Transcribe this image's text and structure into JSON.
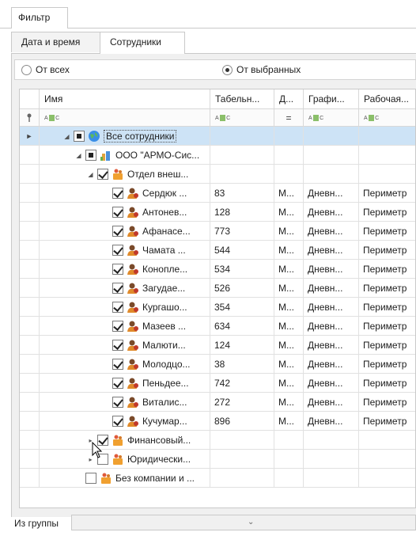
{
  "outer_tab": {
    "label": "Фильтр"
  },
  "inner_tabs": [
    {
      "label": "Дата и время"
    },
    {
      "label": "Сотрудники"
    }
  ],
  "radios": {
    "all": {
      "label": "От всех",
      "checked": false
    },
    "selected": {
      "label": "От выбранных",
      "checked": true
    }
  },
  "grid": {
    "columns": [
      "Имя",
      "Табельн...",
      "Д...",
      "Графи...",
      "Рабочая..."
    ],
    "filter_row": {
      "operator_col2": "="
    },
    "rows": [
      {
        "name": "Все сотрудники",
        "check": "partial",
        "icon": "globe-icon",
        "expander": "◢"
      },
      {
        "name": "ООО \"АРМО-Сис...",
        "check": "partial",
        "icon": "company-icon",
        "expander": "◢"
      },
      {
        "name": "Отдел внеш...",
        "check": "checked",
        "icon": "department-icon",
        "expander": "◢"
      },
      {
        "name": "Сердюк ...",
        "tab": "83",
        "d": "М...",
        "schedule": "Дневн...",
        "zone": "Периметр"
      },
      {
        "name": "Антонев...",
        "tab": "128",
        "d": "М...",
        "schedule": "Дневн...",
        "zone": "Периметр"
      },
      {
        "name": "Афанасе...",
        "tab": "773",
        "d": "М...",
        "schedule": "Дневн...",
        "zone": "Периметр"
      },
      {
        "name": "Чамата ...",
        "tab": "544",
        "d": "М...",
        "schedule": "Дневн...",
        "zone": "Периметр"
      },
      {
        "name": "Коноплe...",
        "tab": "534",
        "d": "М...",
        "schedule": "Дневн...",
        "zone": "Периметр"
      },
      {
        "name": "Загудае...",
        "tab": "526",
        "d": "М...",
        "schedule": "Дневн...",
        "zone": "Периметр"
      },
      {
        "name": "Кургашо...",
        "tab": "354",
        "d": "М...",
        "schedule": "Дневн...",
        "zone": "Периметр"
      },
      {
        "name": "Мазеев ...",
        "tab": "634",
        "d": "М...",
        "schedule": "Дневн...",
        "zone": "Периметр"
      },
      {
        "name": "Малюти...",
        "tab": "124",
        "d": "М...",
        "schedule": "Дневн...",
        "zone": "Периметр"
      },
      {
        "name": "Молодцо...",
        "tab": "38",
        "d": "М...",
        "schedule": "Дневн...",
        "zone": "Периметр"
      },
      {
        "name": "Пеньдее...",
        "tab": "742",
        "d": "М...",
        "schedule": "Дневн...",
        "zone": "Периметр"
      },
      {
        "name": "Виталис...",
        "tab": "272",
        "d": "М...",
        "schedule": "Дневн...",
        "zone": "Периметр"
      },
      {
        "name": "Кучумар...",
        "tab": "896",
        "d": "М...",
        "schedule": "Дневн...",
        "zone": "Периметр"
      },
      {
        "name": "Финансовый...",
        "check": "checked",
        "icon": "department-icon",
        "expander": "▸"
      },
      {
        "name": "Юридически...",
        "check": "unchecked",
        "icon": "department-icon",
        "expander": "▸"
      },
      {
        "name": "Без компании и ...",
        "check": "unchecked",
        "icon": "department-icon",
        "expander": ""
      }
    ]
  },
  "bottom": {
    "label": "Из группы"
  },
  "colors": {
    "selection": "#cde3f6",
    "border": "#c9c9c9"
  }
}
